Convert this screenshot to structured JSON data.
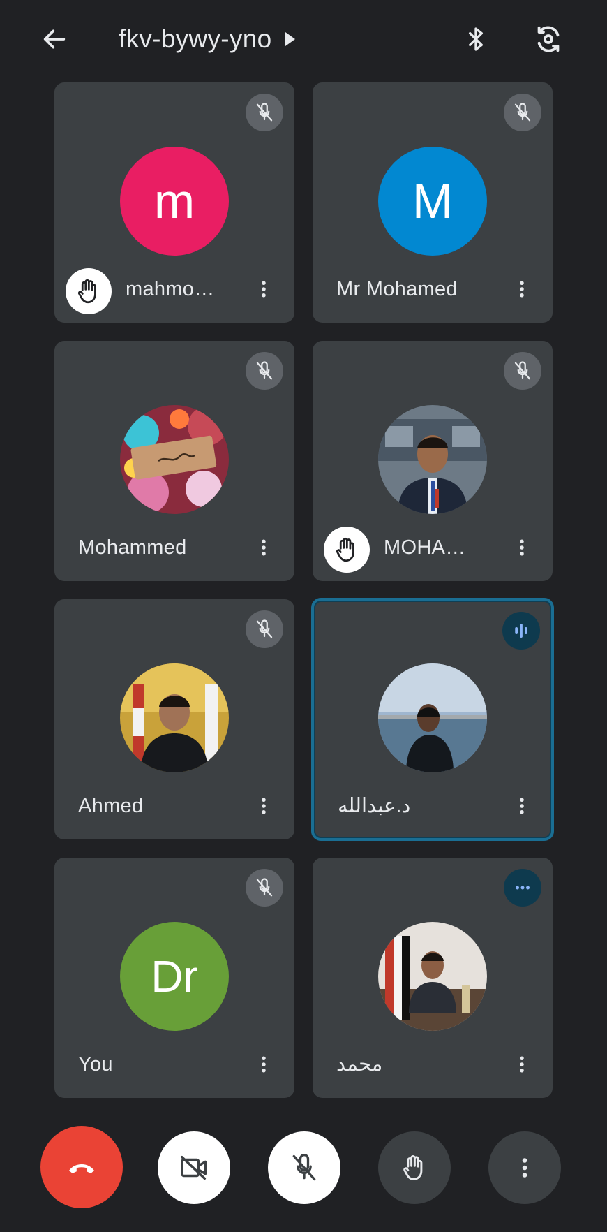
{
  "header": {
    "meeting_code": "fkv-bywy-yno",
    "back_icon": "arrow-left-icon",
    "audio_icon": "bluetooth-icon",
    "camera_switch_icon": "flip-camera-icon"
  },
  "participants": [
    {
      "name": "mahmo…",
      "avatar_letter": "m",
      "avatar_color": "#e91e63",
      "hand_raised": true,
      "state": "muted"
    },
    {
      "name": "Mr Mohamed",
      "avatar_letter": "M",
      "avatar_color": "#0288d1",
      "hand_raised": false,
      "state": "muted"
    },
    {
      "name": "Mohammed",
      "avatar_photo": "photo-handwritten-note",
      "hand_raised": false,
      "state": "muted"
    },
    {
      "name": "MOHA…",
      "avatar_photo": "photo-man-suit-lanyard",
      "hand_raised": true,
      "state": "muted"
    },
    {
      "name": "Ahmed",
      "avatar_photo": "photo-man-flags",
      "hand_raised": false,
      "state": "muted"
    },
    {
      "name": "د.عبدالله",
      "avatar_photo": "photo-man-seaside",
      "hand_raised": false,
      "state": "speaking"
    },
    {
      "name": "You",
      "avatar_letter": "Dr",
      "avatar_color": "#689f38",
      "hand_raised": false,
      "state": "muted"
    },
    {
      "name": "محمد",
      "avatar_photo": "photo-man-desk-flag",
      "hand_raised": false,
      "state": "audio-idle"
    }
  ],
  "controls": {
    "end_call": "end-call-icon",
    "camera": "camera-off-icon",
    "microphone": "mic-off-icon",
    "raise_hand": "raise-hand-icon",
    "more": "more-vert-icon"
  },
  "colors": {
    "background": "#202124",
    "tile": "#3c4043",
    "end_call": "#ea4335",
    "active_border": "#1a6e93"
  }
}
